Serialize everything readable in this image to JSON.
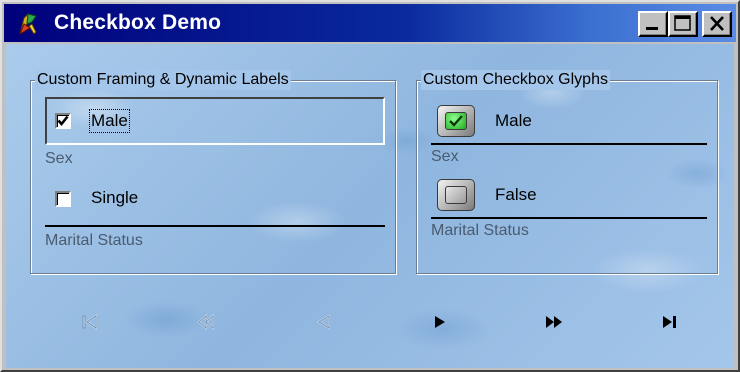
{
  "window": {
    "title": "Checkbox Demo",
    "icon": "rocket-app-icon",
    "buttons": [
      "minimize-icon",
      "maximize-icon",
      "close-icon"
    ]
  },
  "left_group": {
    "legend": "Custom Framing & Dynamic Labels",
    "fields": [
      {
        "checkbox_label": "Male",
        "checked": true,
        "focused": true,
        "field_label": "Sex"
      },
      {
        "checkbox_label": "Single",
        "checked": false,
        "focused": false,
        "field_label": "Marital Status"
      }
    ]
  },
  "right_group": {
    "legend": "Custom Checkbox Glyphs",
    "fields": [
      {
        "checkbox_label": "Male",
        "checked": true,
        "glyph_color": "#3fcf3f",
        "field_label": "Sex"
      },
      {
        "checkbox_label": "False",
        "checked": false,
        "glyph_color": "#c8c8c8",
        "field_label": "Marital Status"
      }
    ]
  },
  "navigator": {
    "buttons": [
      {
        "icon": "first-record-icon",
        "enabled": false
      },
      {
        "icon": "prior-page-icon",
        "enabled": false
      },
      {
        "icon": "prior-record-icon",
        "enabled": false
      },
      {
        "icon": "next-record-icon",
        "enabled": true
      },
      {
        "icon": "next-page-icon",
        "enabled": true
      },
      {
        "icon": "last-record-icon",
        "enabled": true
      }
    ]
  },
  "colors": {
    "titlebar_start": "#00007b",
    "titlebar_end": "#5a8ce6",
    "client_background": "#9fc3e8",
    "field_label_text": "#4a5b70"
  }
}
